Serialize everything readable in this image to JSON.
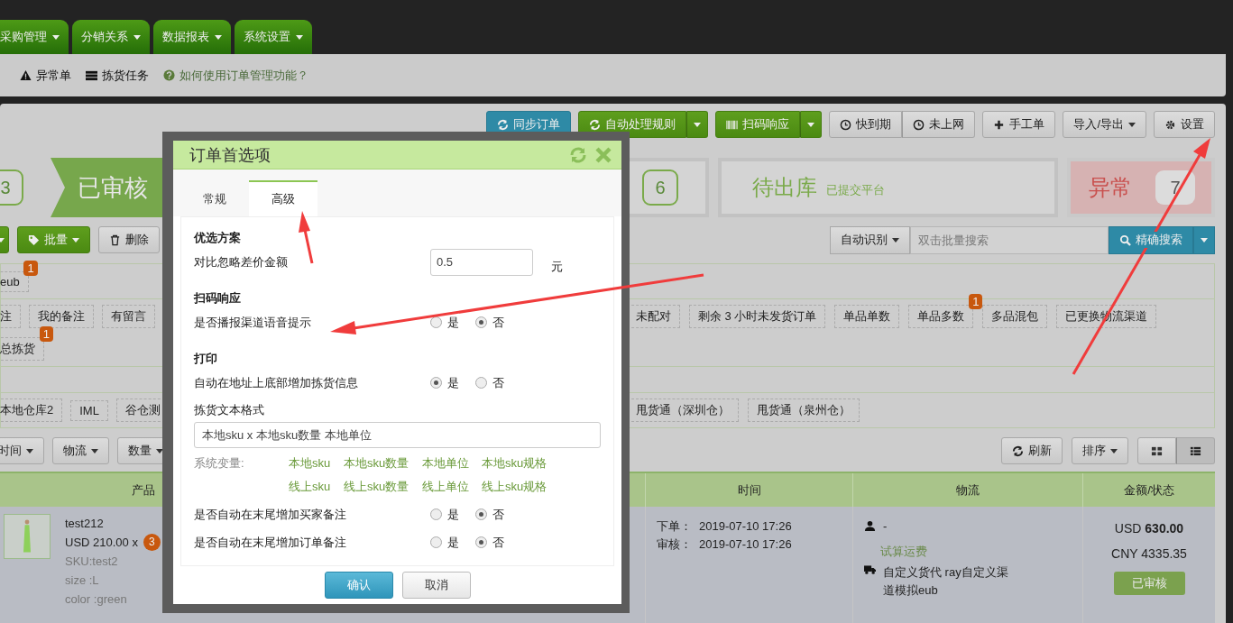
{
  "nav_tabs": [
    {
      "label": "采购管理"
    },
    {
      "label": "分销关系"
    },
    {
      "label": "数据报表"
    },
    {
      "label": "系统设置"
    }
  ],
  "subnav": [
    {
      "label": "异常单",
      "kind": "link"
    },
    {
      "label": "拣货任务",
      "kind": "link"
    },
    {
      "label": "如何使用订单管理功能？",
      "kind": "help"
    }
  ],
  "toolbar": [
    [
      {
        "label": "同步订单",
        "kind": "info",
        "split": false,
        "dropdown": false
      }
    ],
    [
      {
        "label": "自动处理规则",
        "kind": "success",
        "split": true,
        "dropdown": false
      }
    ],
    [
      {
        "label": "扫码响应",
        "kind": "success",
        "split": true,
        "dropdown": false
      }
    ],
    [
      {
        "label": "快到期",
        "kind": "default",
        "split": false,
        "dropdown": false
      },
      {
        "label": "未上网",
        "kind": "default",
        "split": false,
        "dropdown": false
      }
    ],
    [
      {
        "label": "手工单",
        "kind": "default",
        "split": false,
        "dropdown": false
      }
    ],
    [
      {
        "label": "导入/导出",
        "kind": "default",
        "split": false,
        "dropdown": true
      }
    ],
    [
      {
        "label": "设置",
        "kind": "default",
        "split": false,
        "dropdown": false
      }
    ]
  ],
  "steps": {
    "left_count": "3",
    "active_label": "已审核",
    "next_count": "6",
    "next_label": "待出库",
    "next_sub": "已提交平台",
    "alert_label": "异常",
    "alert_count": "7"
  },
  "actions": [
    {
      "label": "批量",
      "kind": "success",
      "dropdown": true
    },
    {
      "label": "删除",
      "kind": "default",
      "dropdown": false
    }
  ],
  "search": {
    "mode": "自动识别",
    "placeholder": "双击批量搜索",
    "button": "精确搜索"
  },
  "filter_sections": [
    {
      "kind": "tags",
      "lines": [
        {
          "left": [
            {
              "label": "eub",
              "badge": "1"
            }
          ]
        }
      ]
    },
    {
      "kind": "tags",
      "lines": [
        {
          "left": [
            {
              "label": "注"
            },
            {
              "label": "我的备注"
            },
            {
              "label": "有留言"
            }
          ],
          "right": [
            {
              "label": "未配对"
            },
            {
              "label": "剩余 3 小时未发货订单"
            },
            {
              "label": "单品单数"
            },
            {
              "label": "单品多数",
              "badge": "1"
            },
            {
              "label": "多品混包"
            },
            {
              "label": "已更换物流渠道"
            }
          ]
        },
        {
          "left": [
            {
              "label": "总拣货",
              "badge": "1"
            }
          ]
        }
      ]
    },
    {
      "kind": "empty"
    },
    {
      "kind": "tags",
      "lines": [
        {
          "left": [
            {
              "label": "本地仓库2"
            },
            {
              "label": "IML"
            },
            {
              "label": "谷仓测"
            }
          ],
          "right": [
            {
              "label": "甩货通（深圳仓）"
            },
            {
              "label": "甩货通（泉州仓）"
            }
          ]
        }
      ]
    }
  ],
  "sort_filters": [
    {
      "label": "时间"
    },
    {
      "label": "物流"
    },
    {
      "label": "数量"
    }
  ],
  "refresh": "刷新",
  "sort": "排序",
  "views": [
    {
      "selected": false
    },
    {
      "selected": true
    }
  ],
  "table": {
    "columns": [
      "产品",
      "时间",
      "物流",
      "金额/状态"
    ],
    "row": {
      "product": {
        "name": "test212",
        "price": "USD 210.00 x",
        "qty": "3",
        "sku": "SKU:test2",
        "attrs": [
          "size :L",
          "color :green"
        ]
      },
      "times": [
        {
          "label": "下单：",
          "value": "2019-07-10 17:26"
        },
        {
          "label": "审核：",
          "value": "2019-07-10 17:26"
        }
      ],
      "logistics": {
        "buyer": "-",
        "quote_link": "试算运费",
        "channel": "自定义货代 ray自定义渠道模拟eub"
      },
      "amount": {
        "usd": "USD **630.00**",
        "cny": "CNY 4335.35",
        "status": "已审核"
      }
    }
  },
  "modal": {
    "title": "订单首选项",
    "tabs": [
      {
        "label": "常规",
        "selected": false
      },
      {
        "label": "高级",
        "selected": true
      }
    ],
    "sections": [
      {
        "heading": "优选方案",
        "rows": [
          {
            "kind": "input",
            "label": "对比忽略差价金额",
            "value": "0.5",
            "unit": "元"
          }
        ]
      },
      {
        "heading": "扫码响应",
        "rows": [
          {
            "kind": "radio",
            "label": "是否播报渠道语音提示",
            "options": [
              {
                "label": "是",
                "selected": false
              },
              {
                "label": "否",
                "selected": true
              }
            ]
          }
        ]
      },
      {
        "heading": "打印",
        "rows": [
          {
            "kind": "radio",
            "label": "自动在地址上底部增加拣货信息",
            "options": [
              {
                "label": "是",
                "selected": true
              },
              {
                "label": "否",
                "selected": false
              }
            ]
          },
          {
            "kind": "text",
            "label": "拣货文本格式",
            "value": "本地sku x 本地sku数量 本地单位"
          },
          {
            "kind": "vars",
            "label": "系统变量:",
            "items": [
              "本地sku",
              "本地sku数量",
              "本地单位",
              "本地sku规格",
              "线上sku",
              "线上sku数量",
              "线上单位",
              "线上sku规格"
            ]
          },
          {
            "kind": "radio",
            "label": "是否自动在末尾增加买家备注",
            "options": [
              {
                "label": "是",
                "selected": false
              },
              {
                "label": "否",
                "selected": true
              }
            ]
          },
          {
            "kind": "radio",
            "label": "是否自动在末尾增加订单备注",
            "options": [
              {
                "label": "是",
                "selected": false
              },
              {
                "label": "否",
                "selected": true
              }
            ]
          }
        ]
      }
    ],
    "buttons": [
      {
        "label": "确认",
        "kind": "primary"
      },
      {
        "label": "取消",
        "kind": "default"
      }
    ]
  }
}
